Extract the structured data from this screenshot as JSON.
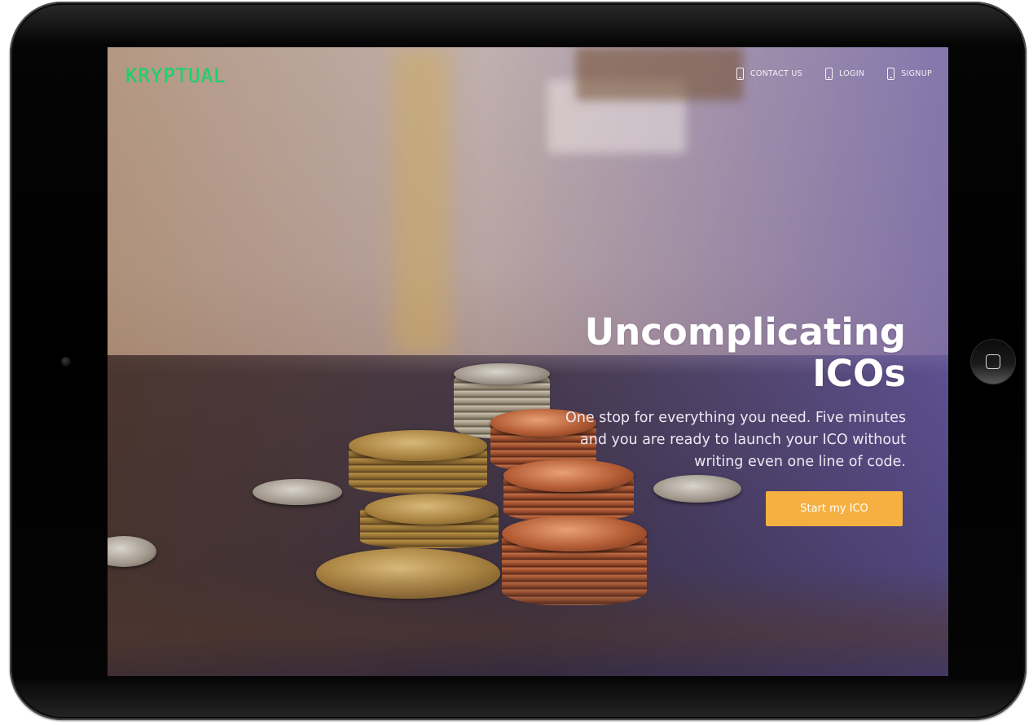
{
  "brand": {
    "logo_text": "KRYPTUAL",
    "logo_color": "#17d36a"
  },
  "nav": {
    "items": [
      {
        "label": "CONTACT US",
        "icon": "phone-icon"
      },
      {
        "label": "LOGIN",
        "icon": "phone-icon"
      },
      {
        "label": "SIGNUP",
        "icon": "phone-icon"
      }
    ]
  },
  "hero": {
    "title": "Uncomplicating\nICOs",
    "subtitle": "One stop for everything you need. Five minutes\nand you are ready to launch your ICO without\nwriting even one line of code.",
    "cta_label": "Start my ICO",
    "cta_color": "#f6b042"
  },
  "device": {
    "type": "tablet",
    "home_button_icon": "home-button-icon",
    "camera_icon": "front-camera-icon"
  }
}
